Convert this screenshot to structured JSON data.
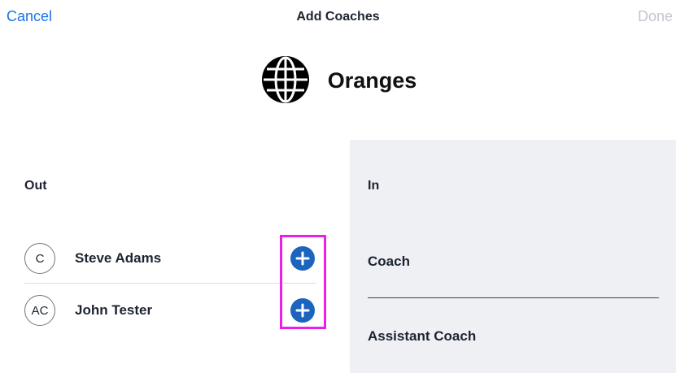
{
  "header": {
    "cancel_label": "Cancel",
    "title": "Add Coaches",
    "done_label": "Done"
  },
  "team": {
    "name": "Oranges",
    "icon": "globe-icon"
  },
  "out_section": {
    "heading": "Out",
    "coaches": [
      {
        "initials": "C",
        "name": "Steve Adams"
      },
      {
        "initials": "AC",
        "name": "John Tester"
      }
    ]
  },
  "in_section": {
    "heading": "In",
    "slots": [
      {
        "label": "Coach"
      },
      {
        "label": "Assistant Coach"
      }
    ]
  },
  "colors": {
    "accent": "#1a73e8",
    "add_button": "#1d64bf",
    "highlight": "#ee1ee9",
    "in_panel_bg": "#eef0f4",
    "done_disabled": "#c2c6cd"
  }
}
